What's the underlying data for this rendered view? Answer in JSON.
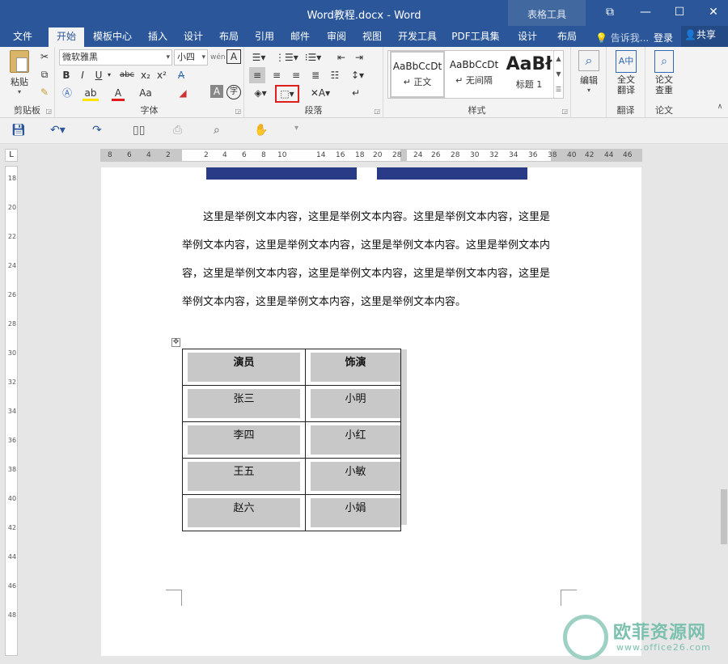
{
  "window": {
    "title": "Word教程.docx - Word",
    "context_tab_group": "表格工具",
    "buttons": {
      "restore": "⧉",
      "minimize": "—",
      "maximize": "☐",
      "close": "✕"
    }
  },
  "tabs": {
    "items": [
      "文件",
      "开始",
      "模板中心",
      "插入",
      "设计",
      "布局",
      "引用",
      "邮件",
      "审阅",
      "视图",
      "开发工具",
      "PDF工具集",
      "设计",
      "布局"
    ],
    "active": "开始",
    "tell_me": "告诉我...",
    "login": "登录",
    "share": "共享"
  },
  "ribbon": {
    "clipboard": {
      "label": "剪贴板",
      "paste": "粘贴"
    },
    "font": {
      "label": "字体",
      "font_name": "微软雅黑",
      "font_size": "小四",
      "bold": "B",
      "italic": "I",
      "underline": "U",
      "strike": "abc",
      "subscript": "x₂",
      "superscript": "x²",
      "case": "Aa"
    },
    "paragraph": {
      "label": "段落"
    },
    "styles": {
      "label": "样式",
      "items": [
        {
          "sample": "AaBbCcDt",
          "name": "↵ 正文"
        },
        {
          "sample": "AaBbCcDt",
          "name": "↵ 无间隔"
        },
        {
          "sample": "AaBł",
          "name": "标题 1"
        }
      ]
    },
    "editing": {
      "label": "编辑"
    },
    "translate": {
      "label": "翻译",
      "button": "全文翻译"
    },
    "paper": {
      "label": "论文",
      "button": "论文查重"
    }
  },
  "ruler": {
    "horizontal_ticks": [
      "8",
      "6",
      "4",
      "2",
      "2",
      "4",
      "6",
      "8",
      "10",
      "14",
      "16",
      "18",
      "20",
      "28",
      "24",
      "26",
      "28",
      "30",
      "32",
      "34",
      "36",
      "38",
      "40",
      "42",
      "44",
      "46"
    ],
    "vertical_ticks": [
      "18",
      "20",
      "22",
      "24",
      "26",
      "28",
      "30",
      "32",
      "34",
      "36",
      "38",
      "40",
      "42",
      "44",
      "46",
      "48"
    ]
  },
  "document": {
    "paragraph": "这里是举例文本内容，这里是举例文本内容。这里是举例文本内容，这里是举例文本内容，这里是举例文本内容，这里是举例文本内容。这里是举例文本内容，这里是举例文本内容，这里是举例文本内容，这里是举例文本内容，这里是举例文本内容，这里是举例文本内容，这里是举例文本内容。",
    "table": {
      "header": [
        "演员",
        "饰演"
      ],
      "rows": [
        [
          "张三",
          "小明"
        ],
        [
          "李四",
          "小红"
        ],
        [
          "王五",
          "小敏"
        ],
        [
          "赵六",
          "小娟"
        ]
      ]
    }
  },
  "watermark": {
    "text": "欧菲资源网",
    "url": "www.office26.com"
  },
  "colors": {
    "accent": "#2b579a",
    "table_cell_shade": "#c8c8c8",
    "header_bar": "#293a86"
  }
}
